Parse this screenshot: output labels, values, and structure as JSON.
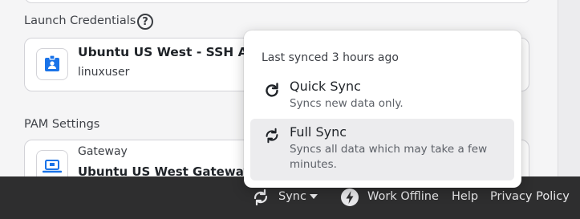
{
  "credentials": {
    "section_title": "Launch Credentials",
    "help_glyph": "?",
    "item_title": "Ubuntu US West - SSH Admin",
    "item_subtitle": "linuxuser"
  },
  "pam": {
    "section_title": "PAM Settings",
    "gateway_label": "Gateway",
    "gateway_value": "Ubuntu US West Gateway"
  },
  "sync_menu": {
    "last_synced": "Last synced 3 hours ago",
    "options": [
      {
        "title": "Quick Sync",
        "description": "Syncs new data only.",
        "icon": "refresh-icon"
      },
      {
        "title": "Full Sync",
        "description_line1": "Syncs all data which may take a few",
        "description_line2": "minutes.",
        "icon": "sync-icon"
      }
    ]
  },
  "footer": {
    "sync_label": "Sync",
    "work_offline_label": "Work Offline",
    "help_label": "Help",
    "privacy_label": "Privacy Policy"
  },
  "colors": {
    "footer_bg": "#2e2e2f",
    "accent_blue": "#1a73e8",
    "hover_bg": "#ececee"
  }
}
